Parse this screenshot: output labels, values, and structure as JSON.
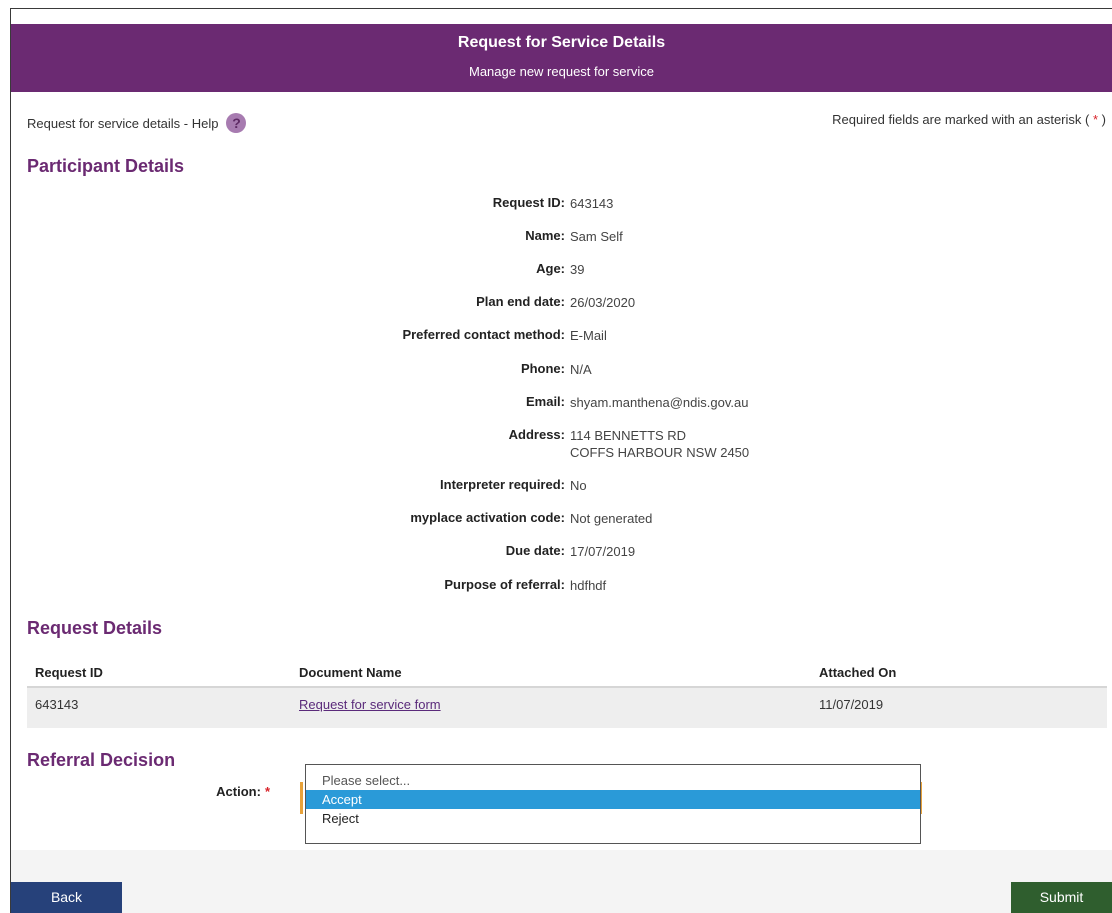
{
  "header": {
    "title": "Request for Service Details",
    "subtitle": "Manage new request for service"
  },
  "help": {
    "label": "Request for service details - Help",
    "icon": "?"
  },
  "required_note": {
    "prefix": "Required fields are marked with an asterisk (",
    "asterisk": "*",
    "suffix": ")"
  },
  "participant": {
    "section_title": "Participant Details",
    "rows": [
      {
        "label": "Request ID:",
        "value": "643143"
      },
      {
        "label": "Name:",
        "value": "Sam Self"
      },
      {
        "label": "Age:",
        "value": "39"
      },
      {
        "label": "Plan end date:",
        "value": "26/03/2020"
      },
      {
        "label": "Preferred contact method:",
        "value": "E-Mail"
      },
      {
        "label": "Phone:",
        "value": "N/A"
      },
      {
        "label": "Email:",
        "value": "shyam.manthena@ndis.gov.au"
      },
      {
        "label": "Address:",
        "value_line1": "114 BENNETTS RD",
        "value_line2": "COFFS HARBOUR NSW 2450"
      },
      {
        "label": "Interpreter required:",
        "value": "No"
      },
      {
        "label": "myplace activation code:",
        "value": "Not generated"
      },
      {
        "label": "Due date:",
        "value": "17/07/2019"
      },
      {
        "label": "Purpose of referral:",
        "value": "hdfhdf"
      }
    ]
  },
  "request_details": {
    "section_title": "Request Details",
    "columns": [
      "Request ID",
      "Document Name",
      "Attached On"
    ],
    "rows": [
      {
        "request_id": "643143",
        "document_name": "Request for service form",
        "attached_on": "11/07/2019"
      }
    ]
  },
  "referral": {
    "section_title": "Referral Decision",
    "action_label": "Action:",
    "asterisk": "*",
    "options": [
      "Please select...",
      "Accept",
      "Reject"
    ],
    "highlighted_option": "Accept"
  },
  "buttons": {
    "back": "Back",
    "submit": "Submit"
  },
  "colors": {
    "brand": "#6b2a72",
    "back": "#26417a",
    "submit": "#2f5e2e",
    "highlight": "#2a9ad8"
  }
}
